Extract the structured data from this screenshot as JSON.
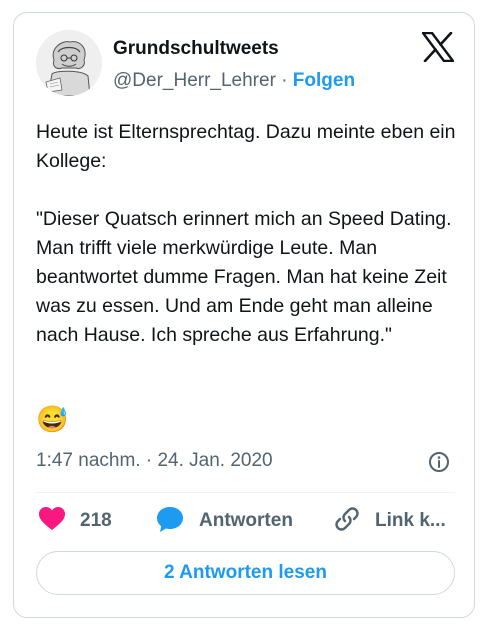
{
  "author": {
    "display_name": "Grundschultweets",
    "handle": "@Der_Herr_Lehrer",
    "separator": "·",
    "follow_label": "Folgen"
  },
  "tweet": {
    "text": "Heute ist Elternsprechtag. Dazu meinte eben ein Kollege:\n\n\"Dieser Quatsch erinnert mich an Speed Dating. Man trifft viele merkwürdige Leute. Man beantwortet dumme Fragen. Man hat keine Zeit was zu essen. Und am Ende geht man alleine nach Hause. Ich spreche aus Erfahrung.\"",
    "emoji": "😅",
    "timestamp": "1:47 nachm. · 24. Jan. 2020"
  },
  "actions": {
    "likes_count": "218",
    "reply_label": "Antworten",
    "copy_link_label": "Link k..."
  },
  "read_replies_label": "2 Antworten lesen",
  "icons": [
    "x-logo-icon",
    "info-icon",
    "heart-icon",
    "reply-bubble-icon",
    "link-icon"
  ],
  "colors": {
    "accent": "#1d9bf0",
    "heart": "#f91880",
    "muted": "#536471",
    "border": "#cfd9de"
  }
}
